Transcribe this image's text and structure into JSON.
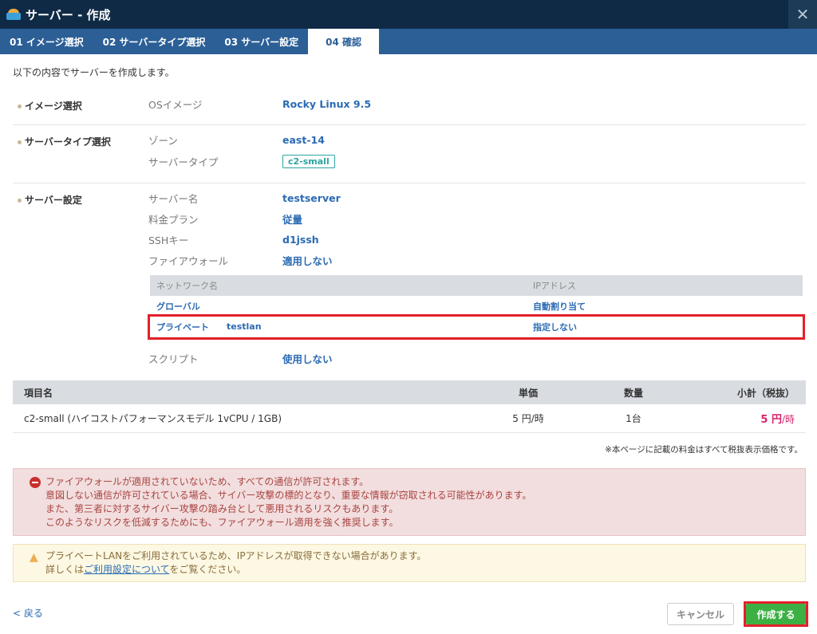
{
  "window": {
    "title": "サーバー - 作成",
    "close_icon": "close-icon"
  },
  "tabs": [
    {
      "label": "01 イメージ選択"
    },
    {
      "label": "02 サーバータイプ選択"
    },
    {
      "label": "03 サーバー設定"
    },
    {
      "label": "04 確認",
      "active": true
    }
  ],
  "intro": "以下の内容でサーバーを作成します。",
  "image_section": {
    "title": "イメージ選択",
    "rows": [
      {
        "label": "OSイメージ",
        "value": "Rocky Linux 9.5"
      }
    ]
  },
  "type_section": {
    "title": "サーバータイプ選択",
    "rows": [
      {
        "label": "ゾーン",
        "value": "east-14"
      },
      {
        "label": "サーバータイプ",
        "value": "c2-small"
      }
    ]
  },
  "server_section": {
    "title": "サーバー設定",
    "rows": [
      {
        "label": "サーバー名",
        "value": "testserver"
      },
      {
        "label": "料金プラン",
        "value": "従量"
      },
      {
        "label": "SSHキー",
        "value": "d1jssh"
      },
      {
        "label": "ファイアウォール",
        "value": "適用しない"
      }
    ],
    "network": {
      "headers": [
        "ネットワーク名",
        "IPアドレス"
      ],
      "rows": [
        {
          "type": "グローバル",
          "name": "",
          "ip": "自動割り当て"
        },
        {
          "type": "プライベート",
          "name": "testlan",
          "ip": "指定しない"
        }
      ]
    },
    "script": {
      "label": "スクリプト",
      "value": "使用しない"
    }
  },
  "price_table": {
    "headers": [
      "項目名",
      "単価",
      "数量",
      "小計（税抜）"
    ],
    "row": {
      "item": "c2-small (ハイコストパフォーマンスモデル 1vCPU / 1GB)",
      "unit_price": "5 円/時",
      "quantity": "1台",
      "subtotal": "5 円",
      "subtotal_unit": "/時"
    },
    "tax_note": "※本ページに記載の料金はすべて税抜表示価格です。"
  },
  "alerts": {
    "danger": [
      "ファイアウォールが適用されていないため、すべての通信が許可されます。",
      "意図しない通信が許可されている場合、サイバー攻撃の標的となり、重要な情報が窃取される可能性があります。",
      "また、第三者に対するサイバー攻撃の踏み台として悪用されるリスクもあります。",
      "このようなリスクを低減するためにも、ファイアウォール適用を強く推奨します。"
    ],
    "warning_line1": "プライベートLANをご利用されているため、IPアドレスが取得できない場合があります。",
    "warning_pre": "詳しくは",
    "warning_link": "ご利用設定について",
    "warning_post": "をご覧ください。"
  },
  "footer": {
    "back": "< 戻る",
    "cancel": "キャンセル",
    "create": "作成する"
  },
  "colors": {
    "header": "#0f2a45",
    "tabs": "#2b5f96",
    "accent_link": "#2b6bb3",
    "create_green": "#3cb043",
    "highlight_red": "#e3202a"
  }
}
